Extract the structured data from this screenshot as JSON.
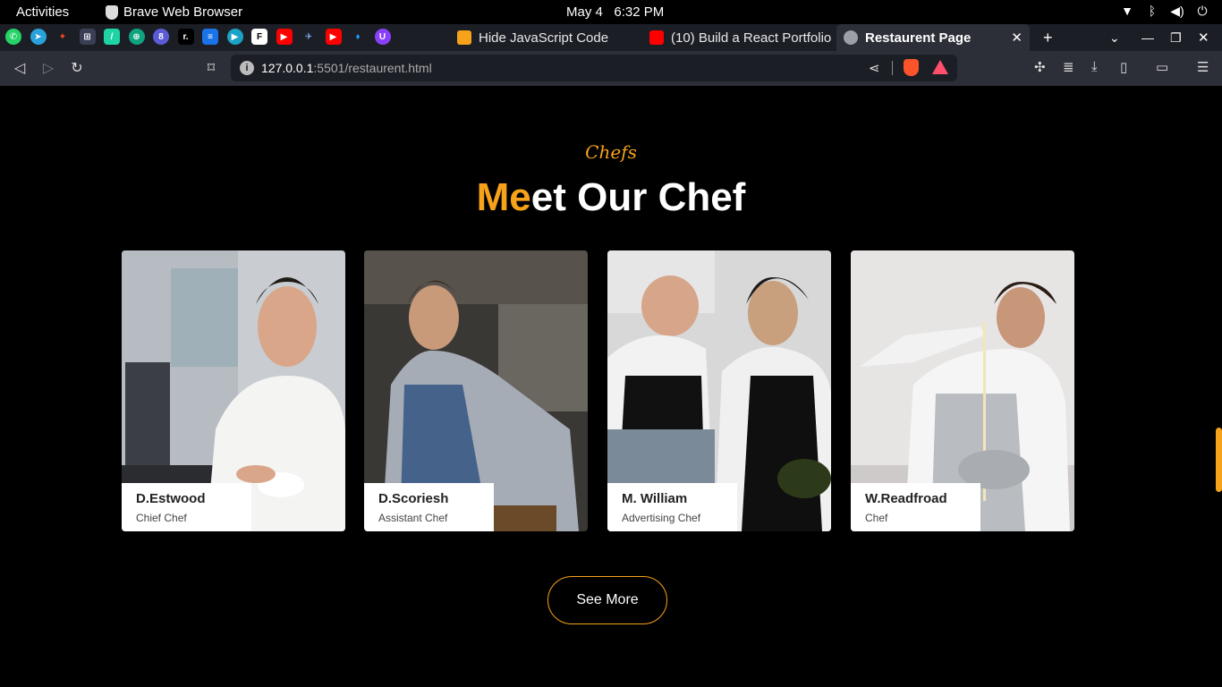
{
  "system": {
    "activities": "Activities",
    "app_name": "Brave Web Browser",
    "date": "May 4",
    "time": "6:32 PM"
  },
  "tabs": [
    {
      "label": "Hide JavaScript Code",
      "icon": "bookmark-icon",
      "color": "#f7a21b"
    },
    {
      "label": "(10) Build a React Portfolio",
      "icon": "youtube-icon",
      "color": "#ff0000"
    },
    {
      "label": "Restaurent Page",
      "icon": "globe-icon",
      "color": "#9aa0a6",
      "active": true
    }
  ],
  "address": {
    "host": "127.0.0.1",
    "path": ":5501/restaurent.html"
  },
  "page": {
    "subtitle": "Chefs",
    "title_accent": "Me",
    "title_rest": "et Our Chef",
    "chefs": [
      {
        "name": "D.Estwood",
        "role": "Chief Chef"
      },
      {
        "name": "D.Scoriesh",
        "role": "Assistant Chef"
      },
      {
        "name": "M. William",
        "role": "Advertising Chef"
      },
      {
        "name": "W.Readfroad",
        "role": "Chef"
      }
    ],
    "button": "See More"
  },
  "colors": {
    "accent": "#f7a21b",
    "background": "#000000"
  }
}
